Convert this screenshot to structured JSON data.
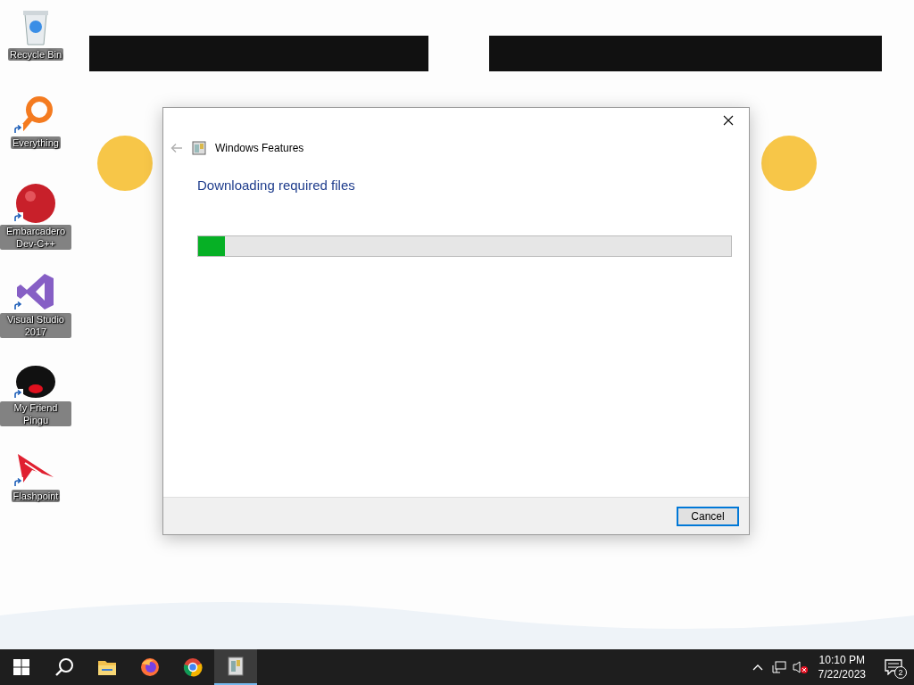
{
  "desktop_icons": [
    {
      "kind": "recycle",
      "label": "Recycle Bin",
      "shortcut": false
    },
    {
      "kind": "magnifier",
      "label": "Everything",
      "shortcut": true
    },
    {
      "kind": "redball",
      "label": "Embarcadero Dev-C++",
      "shortcut": true
    },
    {
      "kind": "studio",
      "label": "Visual Studio 2017",
      "shortcut": true
    },
    {
      "kind": "blob",
      "label": "My Friend Pingu",
      "shortcut": true
    },
    {
      "kind": "dart",
      "label": "Flashpoint",
      "shortcut": true
    }
  ],
  "dialog": {
    "title": "Windows Features",
    "back_disabled": true,
    "heading": "Downloading required files",
    "progress": {
      "level": 0.05
    },
    "buttons": [
      {
        "label": "Cancel",
        "default": true
      }
    ]
  },
  "taskbar": {
    "apps": [
      {
        "kind": "start",
        "selected": false
      },
      {
        "kind": "search",
        "selected": false
      },
      {
        "kind": "folder",
        "selected": false
      },
      {
        "kind": "firefox",
        "selected": false
      },
      {
        "kind": "chrome",
        "selected": false
      },
      {
        "kind": "features",
        "selected": true
      }
    ],
    "clock": {
      "time": "10:10 PM",
      "date": "7/22/2023"
    },
    "notifications": "2"
  }
}
